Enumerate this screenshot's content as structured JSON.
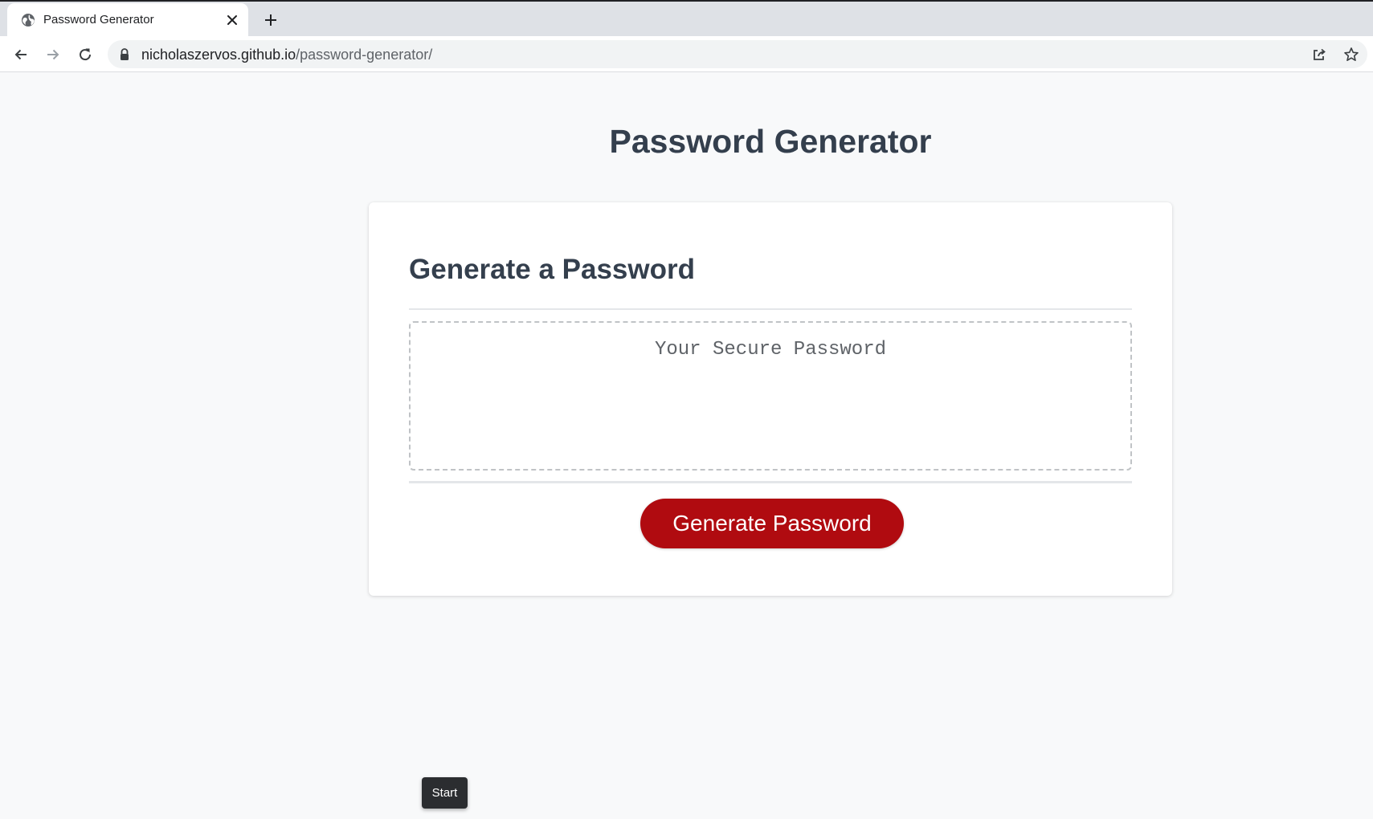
{
  "browser": {
    "tab": {
      "title": "Password Generator",
      "favicon": "globe-icon",
      "close_icon": "close-icon"
    },
    "new_tab_icon": "plus-icon",
    "nav": {
      "back_icon": "back-arrow-icon",
      "forward_icon": "forward-arrow-icon",
      "reload_icon": "reload-icon"
    },
    "address_bar": {
      "host": "nicholaszervos.github.io",
      "path": "/password-generator/",
      "lock_icon": "lock-icon",
      "share_icon": "share-icon",
      "bookmark_icon": "star-icon"
    }
  },
  "page": {
    "title": "Password Generator",
    "card": {
      "title": "Generate a Password",
      "password_placeholder": "Your Secure Password",
      "password_value": "",
      "generate_label": "Generate Password"
    },
    "start_label": "Start"
  },
  "colors": {
    "heading": "#343f4d",
    "button": "#b00b10",
    "background": "#f8f9fa",
    "card": "#ffffff"
  }
}
